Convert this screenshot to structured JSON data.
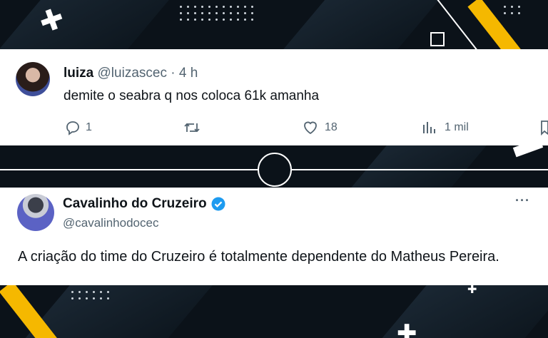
{
  "tweet1": {
    "name": "luiza",
    "handle": "@luizascec",
    "separator": "·",
    "time": "4 h",
    "text": "demite o seabra q nos coloca 61k amanha",
    "actions": {
      "replies": "1",
      "likes": "18",
      "views": "1 mil"
    }
  },
  "tweet2": {
    "name": "Cavalinho do Cruzeiro",
    "handle": "@cavalinhodocec",
    "more": "···",
    "text": "A criação do time do Cruzeiro é totalmente dependente do Matheus Pereira."
  },
  "colors": {
    "background": "#0b1219",
    "accent_yellow": "#f5b800",
    "verified_blue": "#1d9bf0",
    "text_secondary": "#536471"
  },
  "icons": [
    "plus-icon",
    "hollow-square-icon",
    "reply-icon",
    "retweet-icon",
    "like-icon",
    "views-icon",
    "bookmark-icon",
    "verified-badge-icon",
    "more-options-icon"
  ]
}
